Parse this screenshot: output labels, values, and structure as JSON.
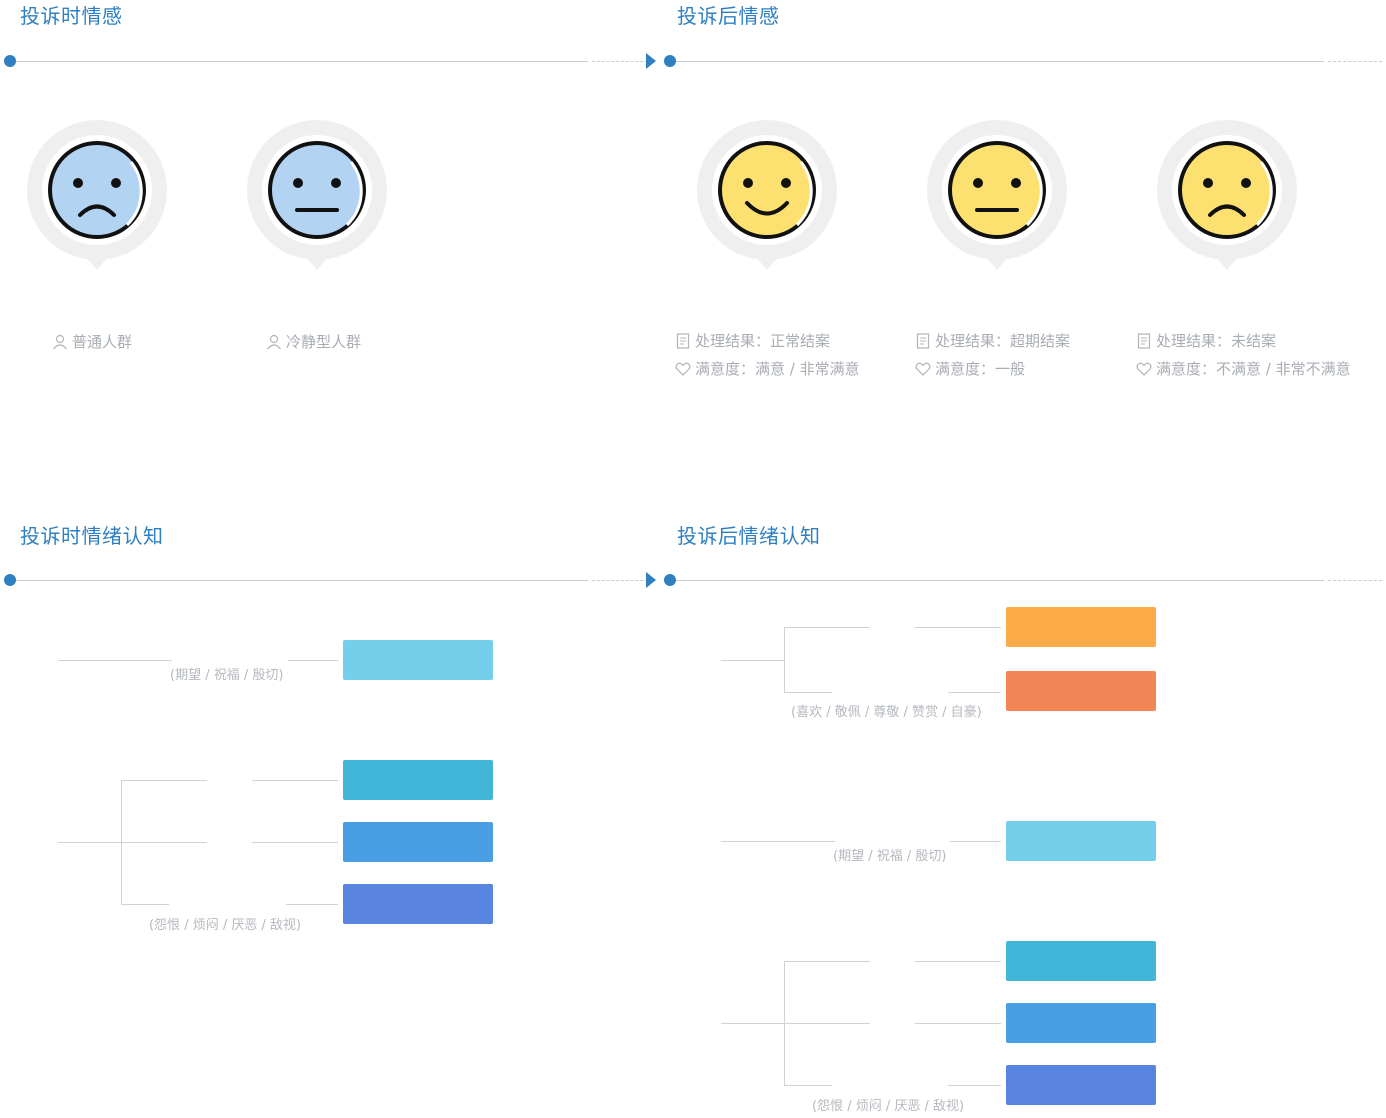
{
  "sections": {
    "during_feeling": {
      "title": "投诉时情感"
    },
    "after_feeling": {
      "title": "投诉后情感"
    },
    "during_cognition": {
      "title": "投诉时情绪认知"
    },
    "after_cognition": {
      "title": "投诉后情绪认知"
    }
  },
  "during_groups": [
    {
      "label": "普通人群"
    },
    {
      "label": "冷静型人群"
    }
  ],
  "after_outcomes": [
    {
      "result": "处理结果：正常结案",
      "satisfaction": "满意度：满意 / 非常满意"
    },
    {
      "result": "处理结果：超期结案",
      "satisfaction": "满意度：一般"
    },
    {
      "result": "处理结果：未结案",
      "satisfaction": "满意度：不满意 / 非常不满意"
    }
  ],
  "cognition": {
    "during": [
      {
        "label": "(期望 / 祝福 / 殷切)"
      },
      {
        "label": "(怨恨 / 烦闷 / 厌恶 / 敌视)"
      }
    ],
    "after": [
      {
        "label": "(喜欢 / 敬佩 / 尊敬 / 赞赏 / 自豪)"
      },
      {
        "label": "(期望 / 祝福 / 殷切)"
      },
      {
        "label": "(怨恨 / 烦闷 / 厌恶 / 敌视)"
      }
    ]
  },
  "colors": {
    "accent": "#2f7fc1",
    "face_blue": "#b3d3f3",
    "face_yellow": "#fde170",
    "box_light_blue": "#76cfea",
    "box_cyan": "#42b6d9",
    "box_blue": "#4a9ee3",
    "box_indigo": "#5883de",
    "box_orange": "#fdaa48",
    "box_coral": "#f28556"
  }
}
